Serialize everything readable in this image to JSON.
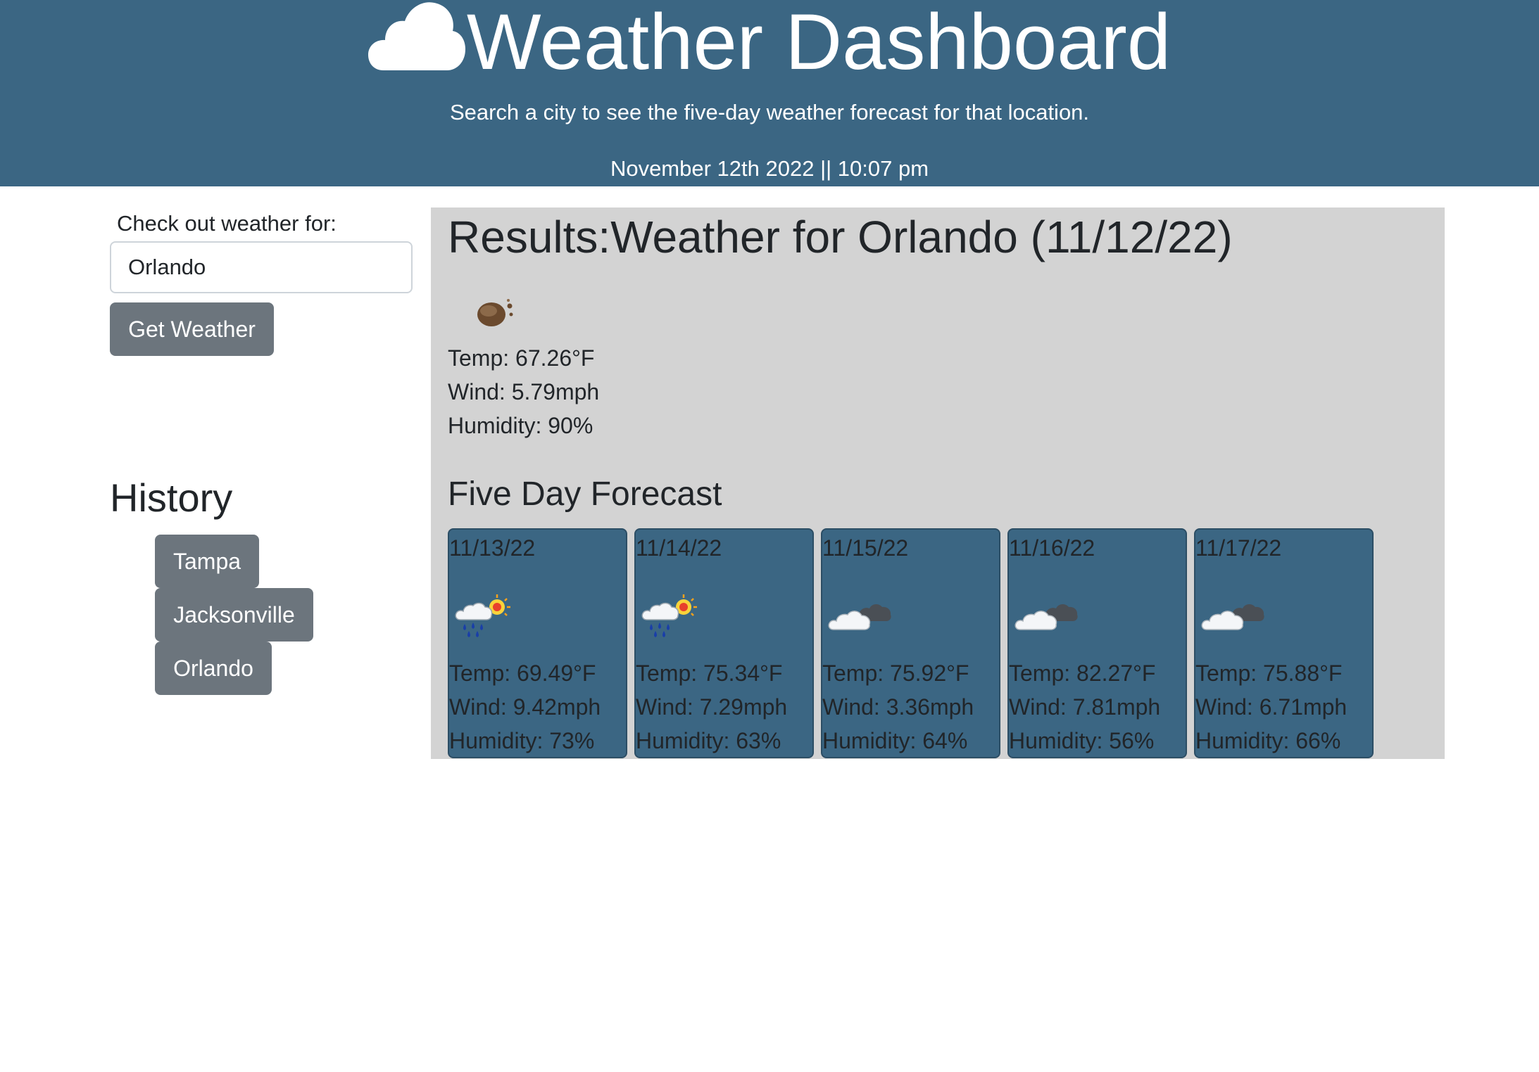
{
  "header": {
    "title": "Weather Dashboard",
    "subtitle": "Search a city to see the five-day weather forecast for that location.",
    "datetime": "November 12th 2022 || 10:07 pm",
    "logo_icon": "cloud-icon"
  },
  "search": {
    "label": "Check out weather for:",
    "value": "Orlando",
    "button_label": "Get Weather"
  },
  "history": {
    "title": "History",
    "items": [
      "Tampa",
      "Jacksonville",
      "Orlando"
    ]
  },
  "results": {
    "title": "Results:Weather for Orlando (11/12/22)",
    "icon": "mist-icon",
    "temp": "Temp: 67.26°F",
    "wind": "Wind: 5.79mph",
    "humidity": "Humidity: 90%"
  },
  "forecast": {
    "title": "Five Day Forecast",
    "days": [
      {
        "date": "11/13/22",
        "icon": "sun-rain-icon",
        "temp": "Temp: 69.49°F",
        "wind": "Wind: 9.42mph",
        "humidity": "Humidity: 73%"
      },
      {
        "date": "11/14/22",
        "icon": "sun-rain-icon",
        "temp": "Temp: 75.34°F",
        "wind": "Wind: 7.29mph",
        "humidity": "Humidity: 63%"
      },
      {
        "date": "11/15/22",
        "icon": "clouds-icon",
        "temp": "Temp: 75.92°F",
        "wind": "Wind: 3.36mph",
        "humidity": "Humidity: 64%"
      },
      {
        "date": "11/16/22",
        "icon": "clouds-icon",
        "temp": "Temp: 82.27°F",
        "wind": "Wind: 7.81mph",
        "humidity": "Humidity: 56%"
      },
      {
        "date": "11/17/22",
        "icon": "clouds-icon",
        "temp": "Temp: 75.88°F",
        "wind": "Wind: 6.71mph",
        "humidity": "Humidity: 66%"
      }
    ]
  },
  "colors": {
    "header_bg": "#3b6683",
    "card_bg": "#3b6683",
    "results_bg": "#d3d3d3",
    "button_bg": "#6c757d"
  }
}
